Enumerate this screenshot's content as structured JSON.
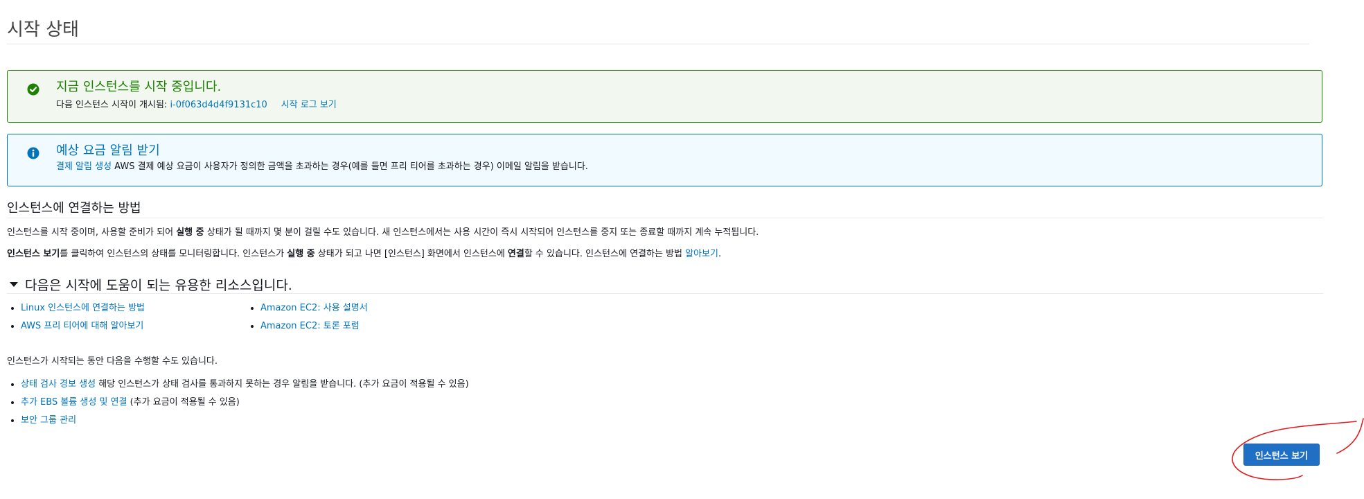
{
  "page": {
    "title": "시작 상태"
  },
  "success_alert": {
    "heading": "지금 인스턴스를 시작 중입니다.",
    "body_prefix": "다음 인스턴스 시작이 개시됨: ",
    "instance_id": "i-0f063d4d4f9131c10",
    "log_link": "시작 로그 보기",
    "icon": "check-circle-icon",
    "color": "#1d8102"
  },
  "info_alert": {
    "heading": "예상 요금 알림 받기",
    "link": "결제 알림 생성",
    "body": " AWS 결제 예상 요금이 사용자가 정의한 금액을 초과하는 경우(예를 들면 프리 티어를 초과하는 경우) 이메일 알림을 받습니다.",
    "icon": "info-circle-icon",
    "color": "#0073bb"
  },
  "connect": {
    "heading": "인스턴스에 연결하는 방법",
    "p1_a": "인스턴스를 시작 중이며, 사용할 준비가 되어 ",
    "p1_bold": "실행 중",
    "p1_b": " 상태가 될 때까지 몇 분이 걸릴 수도 있습니다. 새 인스턴스에서는 사용 시간이 즉시 시작되어 인스턴스를 중지 또는 종료할 때까지 계속 누적됩니다.",
    "p2_bold1": "인스턴스 보기",
    "p2_a": "를 클릭하여 인스턴스의 상태를 모니터링합니다. 인스턴스가 ",
    "p2_bold2": "실행 중",
    "p2_b": " 상태가 되고 나면 [인스턴스] 화면에서 인스턴스에 ",
    "p2_bold3": "연결",
    "p2_c": "할 수 있습니다. 인스턴스에 연결하는 방법 ",
    "p2_link": "알아보기",
    "p2_end": "."
  },
  "resources": {
    "heading": "다음은 시작에 도움이 되는 유용한 리소스입니다.",
    "col1": [
      {
        "label": "Linux 인스턴스에 연결하는 방법"
      },
      {
        "label": "AWS 프리 티어에 대해 알아보기"
      }
    ],
    "col2": [
      {
        "label": "Amazon EC2: 사용 설명서"
      },
      {
        "label": "Amazon EC2: 토론 포럼"
      }
    ]
  },
  "actions": {
    "intro": "인스턴스가 시작되는 동안 다음을 수행할 수도 있습니다.",
    "items": [
      {
        "link": "상태 검사 경보 생성",
        "text": " 해당 인스턴스가 상태 검사를 통과하지 못하는 경우 알림을 받습니다. (추가 요금이 적용될 수 있음)"
      },
      {
        "link": "추가 EBS 볼륨 생성 및 연결",
        "text": " (추가 요금이 적용될 수 있음)"
      },
      {
        "link": "보안 그룹 관리",
        "text": ""
      }
    ]
  },
  "footer": {
    "view_instances_label": "인스턴스 보기",
    "button_color": "#1f6fc5",
    "annotation_color": "#e11d1d"
  }
}
